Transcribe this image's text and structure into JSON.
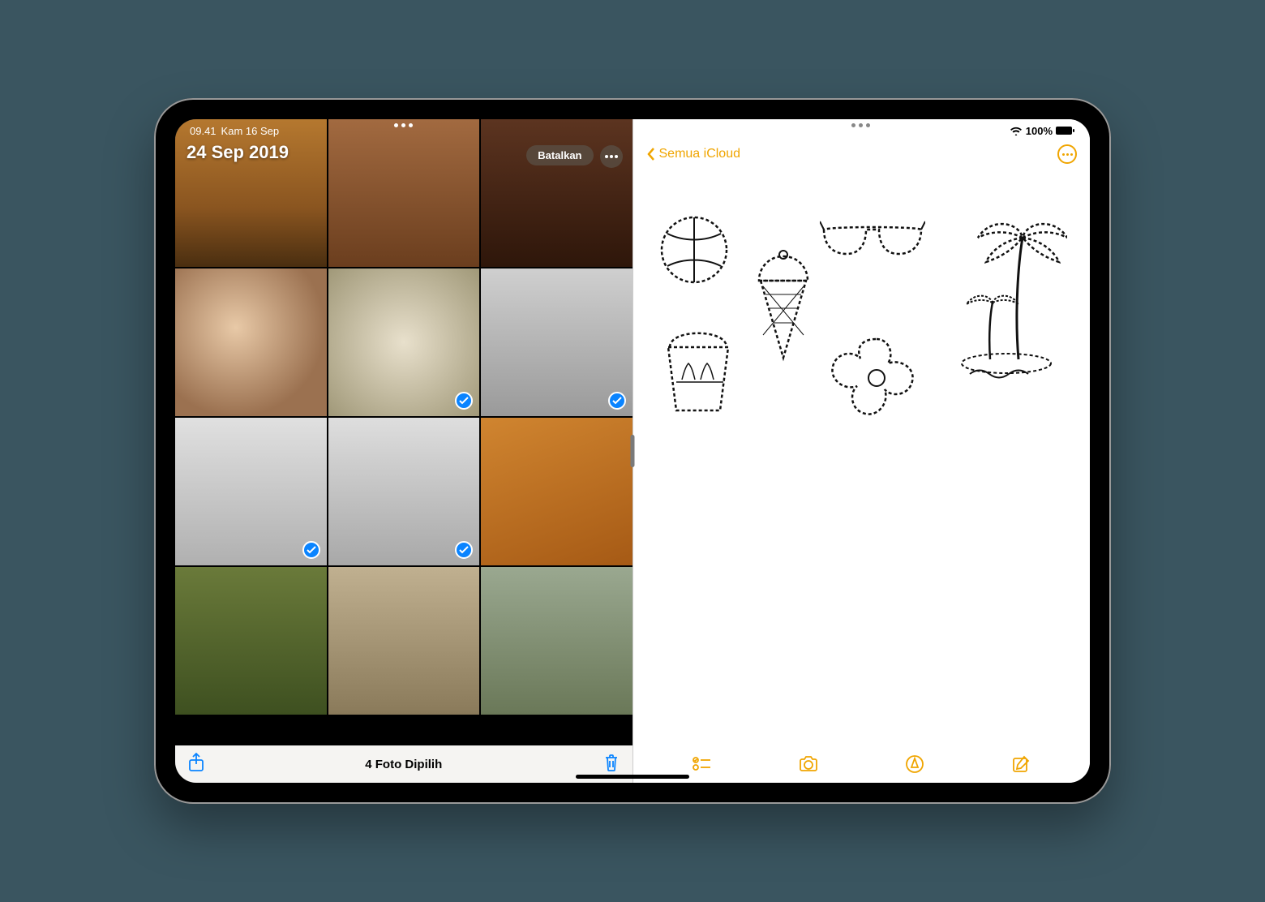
{
  "status": {
    "time": "09.41",
    "date": "Kam 16 Sep",
    "battery_pct": "100%"
  },
  "photos": {
    "date_header": "24 Sep 2019",
    "cancel_label": "Batalkan",
    "selection_label": "4 Foto Dipilih",
    "thumbs": [
      {
        "bg": "bg1",
        "selected": false
      },
      {
        "bg": "bg2",
        "selected": false
      },
      {
        "bg": "bg3",
        "selected": false
      },
      {
        "bg": "bg4",
        "selected": false
      },
      {
        "bg": "bg5",
        "selected": true
      },
      {
        "bg": "bg6",
        "selected": true
      },
      {
        "bg": "bg7",
        "selected": true
      },
      {
        "bg": "bg8",
        "selected": true
      },
      {
        "bg": "bg9",
        "selected": false
      },
      {
        "bg": "bg10",
        "selected": false
      },
      {
        "bg": "bg11",
        "selected": false
      },
      {
        "bg": "bg12",
        "selected": false
      }
    ]
  },
  "notes": {
    "back_label": "Semua iCloud",
    "doodles": [
      "beach-ball",
      "sunglasses",
      "palm-trees",
      "ice-cream",
      "flower",
      "sand-bucket"
    ]
  }
}
